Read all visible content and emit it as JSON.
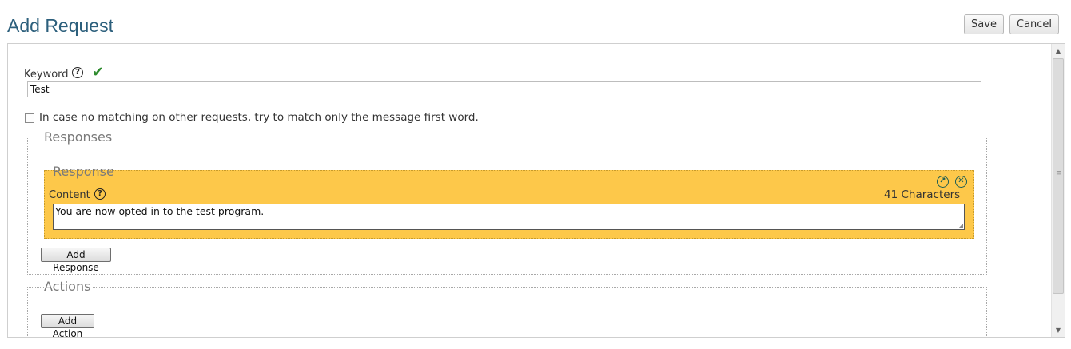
{
  "header": {
    "title": "Add Request",
    "save_label": "Save",
    "cancel_label": "Cancel"
  },
  "form": {
    "keyword_label": "Keyword",
    "keyword_value": "Test",
    "keyword_valid_icon": "check-icon",
    "first_word_checkbox": {
      "checked": false,
      "label": "In case no matching on other requests, try to match only the message first word."
    },
    "responses": {
      "legend": "Responses",
      "items": [
        {
          "legend": "Response",
          "content_label": "Content",
          "char_count": "41 Characters",
          "content_value": "You are now opted in to the test program."
        }
      ],
      "add_button": "Add Response"
    },
    "actions": {
      "legend": "Actions",
      "add_button": "Add Action"
    }
  },
  "colors": {
    "title": "#2c5f7c",
    "response_bg": "#fdc84a",
    "valid_check": "#2e8b2e",
    "icon_teal": "#1a5c55"
  }
}
